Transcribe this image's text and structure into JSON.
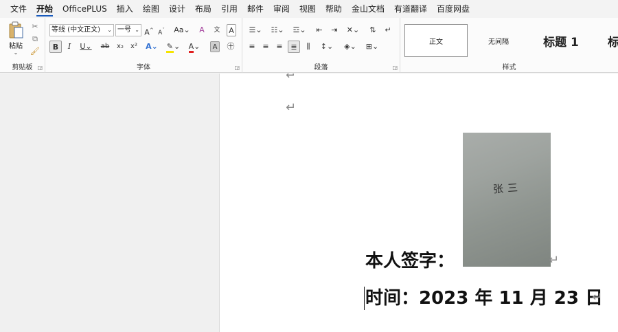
{
  "menu": {
    "items": [
      "文件",
      "开始",
      "OfficePLUS",
      "插入",
      "绘图",
      "设计",
      "布局",
      "引用",
      "邮件",
      "审阅",
      "视图",
      "帮助",
      "金山文档",
      "有道翻译",
      "百度网盘"
    ],
    "active_index": 1
  },
  "ribbon": {
    "clipboard": {
      "label": "剪贴板",
      "paste_label": "粘贴",
      "icons": [
        "scissors-icon",
        "copy-icon",
        "format-painter-icon"
      ]
    },
    "font": {
      "label": "字体",
      "font_name": "等线 (中文正文)",
      "font_size": "一号",
      "row1": [
        "A^",
        "A˅",
        "Aa",
        "A⌫",
        "wén",
        "A"
      ],
      "row2": [
        "B",
        "I",
        "U",
        "ab",
        "x₂",
        "x²",
        "A",
        "ab",
        "A",
        "A",
        "字"
      ]
    },
    "paragraph": {
      "label": "段落"
    },
    "styles": {
      "label": "样式",
      "items": [
        "正文",
        "无间隔",
        "标题 1",
        "标"
      ]
    }
  },
  "document": {
    "signature_label": "本人签字：",
    "signature_name": "张三",
    "date_line": "时间：2023 年 11 月 23 日",
    "paragraph_mark": "↵"
  }
}
